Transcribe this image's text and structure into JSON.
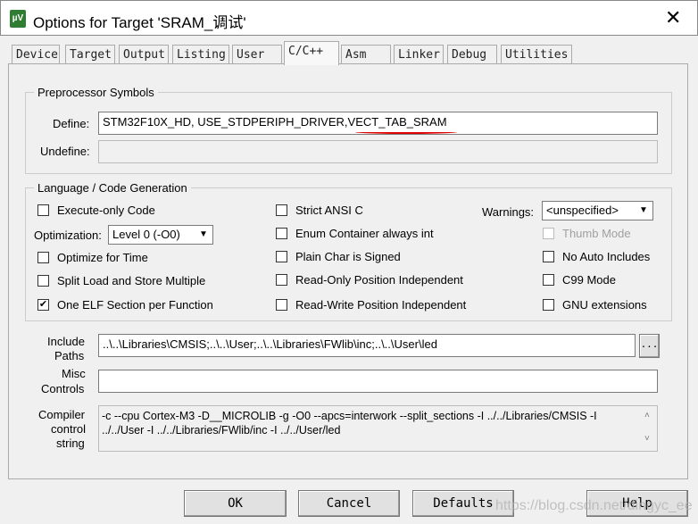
{
  "window": {
    "title": "Options for Target 'SRAM_调试'",
    "close": "✕",
    "icon_text": "µV"
  },
  "tabs": [
    "Device",
    "Target",
    "Output",
    "Listing",
    "User",
    "C/C++",
    "Asm",
    "Linker",
    "Debug",
    "Utilities"
  ],
  "active_tab": "C/C++",
  "preprocessor": {
    "group": "Preprocessor Symbols",
    "define_label": "Define:",
    "define_value": "STM32F10X_HD, USE_STDPERIPH_DRIVER,VECT_TAB_SRAM",
    "undefine_label": "Undefine:",
    "undefine_value": "",
    "annotation_color": "#e00000"
  },
  "language": {
    "group": "Language / Code Generation",
    "execute_only": {
      "label": "Execute-only Code",
      "checked": false
    },
    "optimization_label": "Optimization:",
    "optimization_value": "Level 0 (-O0)",
    "optimize_time": {
      "label": "Optimize for Time",
      "checked": false
    },
    "split_load": {
      "label": "Split Load and Store Multiple",
      "checked": false
    },
    "one_elf": {
      "label": "One ELF Section per Function",
      "checked": true
    },
    "strict_ansi": {
      "label": "Strict ANSI C",
      "checked": false
    },
    "enum_int": {
      "label": "Enum Container always int",
      "checked": false
    },
    "plain_char": {
      "label": "Plain Char is Signed",
      "checked": false
    },
    "ro_pi": {
      "label": "Read-Only Position Independent",
      "checked": false
    },
    "rw_pi": {
      "label": "Read-Write Position Independent",
      "checked": false
    },
    "warnings_label": "Warnings:",
    "warnings_value": "<unspecified>",
    "thumb": {
      "label": "Thumb Mode",
      "checked": false
    },
    "no_auto": {
      "label": "No Auto Includes",
      "checked": false
    },
    "c99": {
      "label": "C99 Mode",
      "checked": false
    },
    "gnu": {
      "label": "GNU extensions",
      "checked": false
    }
  },
  "include": {
    "label1": "Include",
    "label2": "Paths",
    "value": "..\\..\\Libraries\\CMSIS;..\\..\\User;..\\..\\Libraries\\FWlib\\inc;..\\..\\User\\led",
    "browse": "..."
  },
  "misc": {
    "label1": "Misc",
    "label2": "Controls",
    "value": ""
  },
  "compiler": {
    "label1": "Compiler",
    "label2": "control",
    "label3": "string",
    "line1": "-c --cpu Cortex-M3 -D__MICROLIB -g -O0 --apcs=interwork --split_sections -I ../../Libraries/CMSIS -I",
    "line2": "../../User -I ../../Libraries/FWlib/inc -I ../../User/led"
  },
  "buttons": {
    "ok": "OK",
    "cancel": "Cancel",
    "defaults": "Defaults",
    "help": "Help"
  },
  "watermark": "https://blog.csdn.net/dingyc_ee"
}
